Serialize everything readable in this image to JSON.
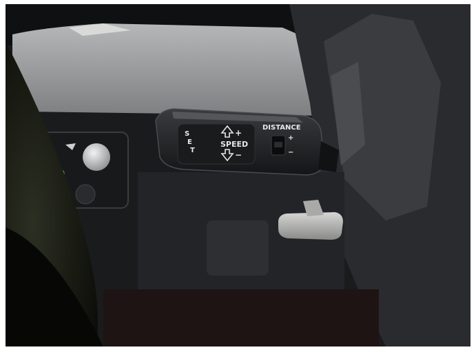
{
  "stalk": {
    "set_letters": [
      "S",
      "E",
      "T"
    ],
    "speed_label": "SPEED",
    "speed_plus": "+",
    "speed_minus": "−",
    "distance_label": "DISTANCE",
    "distance_plus": "+",
    "distance_minus": "−"
  },
  "icons": [
    "orange-indicator-icon",
    "green-headlight-icon",
    "green-parking-light-icon",
    "fog-light-icon",
    "wiper-icon"
  ],
  "colors": {
    "dashboard_trim": "#9a9c9e",
    "stalk_body": "#1e1f22",
    "label_text": "#e8e8e8",
    "indicator_green": "#2bd24a",
    "indicator_orange": "#f08a1c"
  }
}
